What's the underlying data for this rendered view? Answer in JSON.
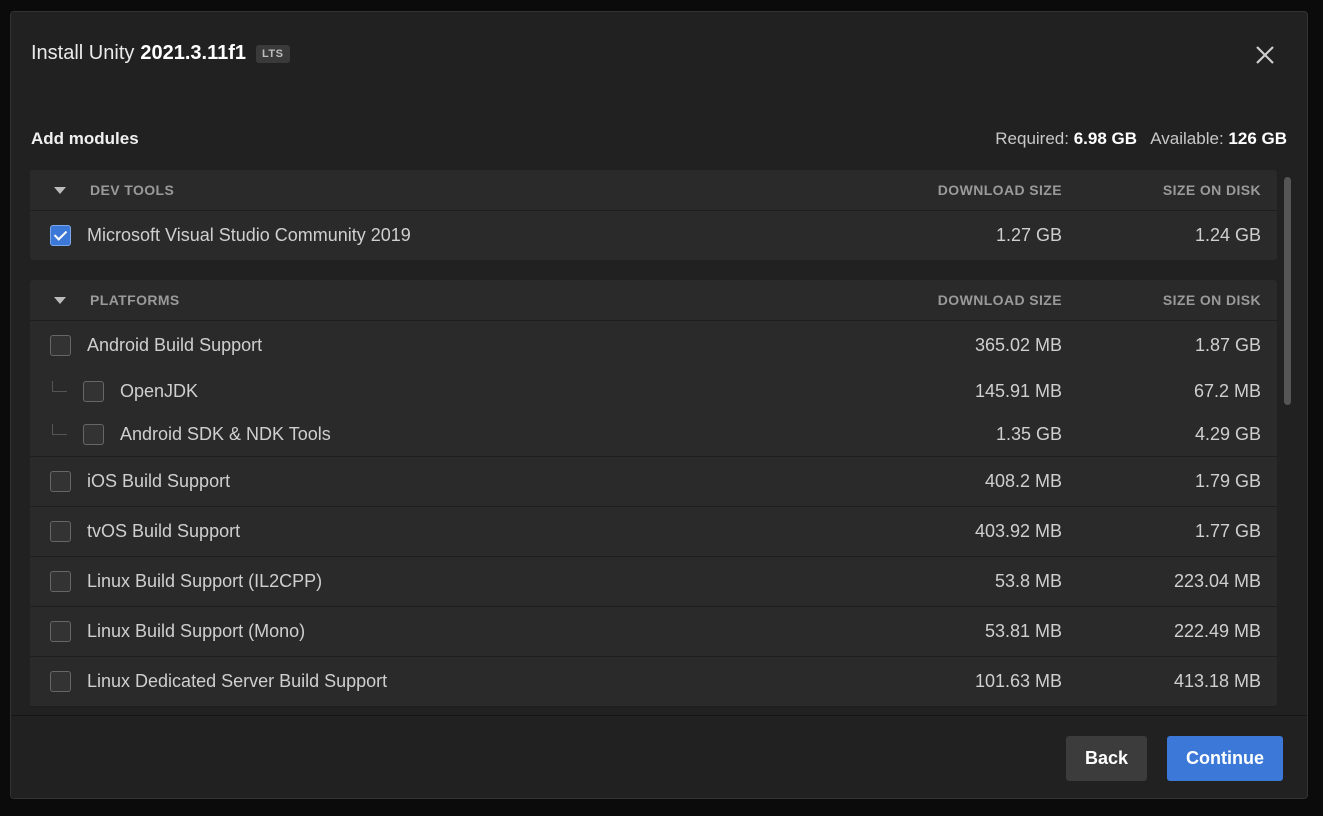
{
  "dialog": {
    "title_prefix": "Install Unity",
    "version": "2021.3.11f1",
    "badge": "LTS"
  },
  "modules": {
    "heading": "Add modules",
    "required_label": "Required:",
    "required_value": "6.98 GB",
    "available_label": "Available:",
    "available_value": "126 GB"
  },
  "groups": {
    "dev_tools": {
      "title": "DEV TOOLS",
      "col_download": "DOWNLOAD SIZE",
      "col_disk": "SIZE ON DISK",
      "items": [
        {
          "label": "Microsoft Visual Studio Community 2019",
          "download": "1.27 GB",
          "disk": "1.24 GB",
          "checked": true
        }
      ]
    },
    "platforms": {
      "title": "PLATFORMS",
      "col_download": "DOWNLOAD SIZE",
      "col_disk": "SIZE ON DISK",
      "items": [
        {
          "label": "Android Build Support",
          "download": "365.02 MB",
          "disk": "1.87 GB",
          "checked": false
        },
        {
          "label": "OpenJDK",
          "download": "145.91 MB",
          "disk": "67.2 MB",
          "checked": false
        },
        {
          "label": "Android SDK & NDK Tools",
          "download": "1.35 GB",
          "disk": "4.29 GB",
          "checked": false
        },
        {
          "label": "iOS Build Support",
          "download": "408.2 MB",
          "disk": "1.79 GB",
          "checked": false
        },
        {
          "label": "tvOS Build Support",
          "download": "403.92 MB",
          "disk": "1.77 GB",
          "checked": false
        },
        {
          "label": "Linux Build Support (IL2CPP)",
          "download": "53.8 MB",
          "disk": "223.04 MB",
          "checked": false
        },
        {
          "label": "Linux Build Support (Mono)",
          "download": "53.81 MB",
          "disk": "222.49 MB",
          "checked": false
        },
        {
          "label": "Linux Dedicated Server Build Support",
          "download": "101.63 MB",
          "disk": "413.18 MB",
          "checked": false
        }
      ]
    }
  },
  "footer": {
    "back_label": "Back",
    "continue_label": "Continue"
  },
  "colors": {
    "accent": "#3b78d8",
    "background": "#212121"
  }
}
